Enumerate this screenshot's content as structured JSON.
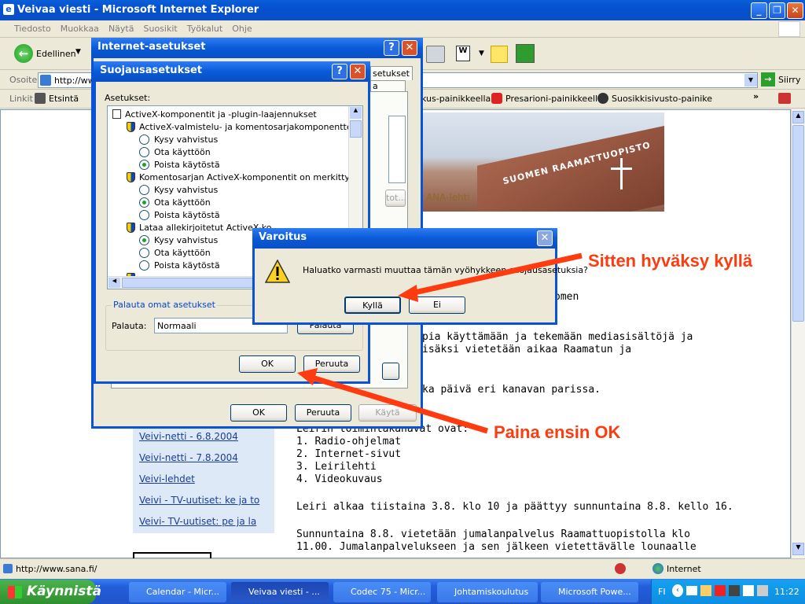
{
  "window": {
    "title": "Veivaa viesti - Microsoft Internet Explorer"
  },
  "menu": [
    "Tiedosto",
    "Muokkaa",
    "Näytä",
    "Suosikit",
    "Työkalut",
    "Ohje"
  ],
  "toolbar": {
    "back_label": "Edellinen"
  },
  "address": {
    "label": "Osoite",
    "value": "http://ww",
    "go_label": "Siirry"
  },
  "links": {
    "label": "Linkit",
    "search_label": "Etsintä",
    "item1": "kus-painikkeella",
    "item2": "Presarioni-painikkeella",
    "item3": "Suosikkisivusto-painike"
  },
  "page": {
    "sidelinks": [
      "Veivi-netti - 6.8.2004",
      "Veivi-netti - 7.8.2004",
      "Veivi-lehdet",
      "Veivi - TV-uutiset: ke ja to",
      "Veivi- TV-uutiset: pe ja la"
    ],
    "header_text": "ANA-lehti",
    "banner_text": "SUOMEN RAAMATTUOPISTO",
    "frag1": "omen",
    "frag2": "pia käyttämään ja tekemään mediasisältöjä ja",
    "frag3": "isäksi vietetään aikaa Raamatun ja",
    "frag4": "ka päivä eri kanavan parissa.",
    "channels_intro": "Leirin toimintakanavat ovat:",
    "channels": [
      "1. Radio-ohjelmat",
      "2. Internet-sivut",
      "3. Leirilehti",
      "4. Videokuvaus"
    ],
    "para1": "Leiri alkaa tiistaina 3.8. klo 10 ja päättyy sunnuntaina 8.8. kello 16.",
    "para2a": "Sunnuntaina 8.8. vietetään jumalanpalvelus Raamattuopistolla klo",
    "para2b": "11.00. Jumalanpalvelukseen ja sen jälkeen vietettävälle lounaalle"
  },
  "internet_options": {
    "title": "Internet-asetukset",
    "tab": "setukset",
    "partial_btn": "tot...",
    "ok": "OK",
    "cancel": "Peruuta",
    "apply": "Käytä"
  },
  "security_settings": {
    "title": "Suojausasetukset",
    "settings_label": "Asetukset:",
    "group": "ActiveX-komponentit ja -plugin-laajennukset",
    "item1": "ActiveX-valmistelu- ja komentosarjakomponentteja ei m",
    "item2": "Komentosarjan ActiveX-komponentit on merkitty turval",
    "item3": "Lataa allekirjoitetut ActiveX-ko",
    "opt_ask": "Kysy vahvistus",
    "opt_enable": "Ota käyttöön",
    "opt_disable": "Poista käytöstä",
    "reset_group": "Palauta omat asetukset",
    "reset_label": "Palauta:",
    "reset_value": "Normaali",
    "reset_btn": "Palauta",
    "ok": "OK",
    "cancel": "Peruuta"
  },
  "warning": {
    "title": "Varoitus",
    "message": "Haluatko varmasti muuttaa tämän vyöhykkeen suojausasetuksia?",
    "yes": "Kyllä",
    "no": "Ei"
  },
  "annotations": {
    "first": "Paina ensin OK",
    "then": "Sitten hyväksy kyllä"
  },
  "status": {
    "url": "http://www.sana.fi/",
    "zone": "Internet"
  },
  "taskbar": {
    "start": "Käynnistä",
    "tasks": [
      "Calendar - Micr...",
      "Veivaa viesti - ...",
      "Codec 75 - Micr...",
      "Johtamiskoulutus",
      "Microsoft Powe..."
    ],
    "lang": "FI",
    "clock": "11:22"
  },
  "colors": {
    "annotation": "#ff3b0f",
    "title_blue": "#0a5ad8"
  }
}
